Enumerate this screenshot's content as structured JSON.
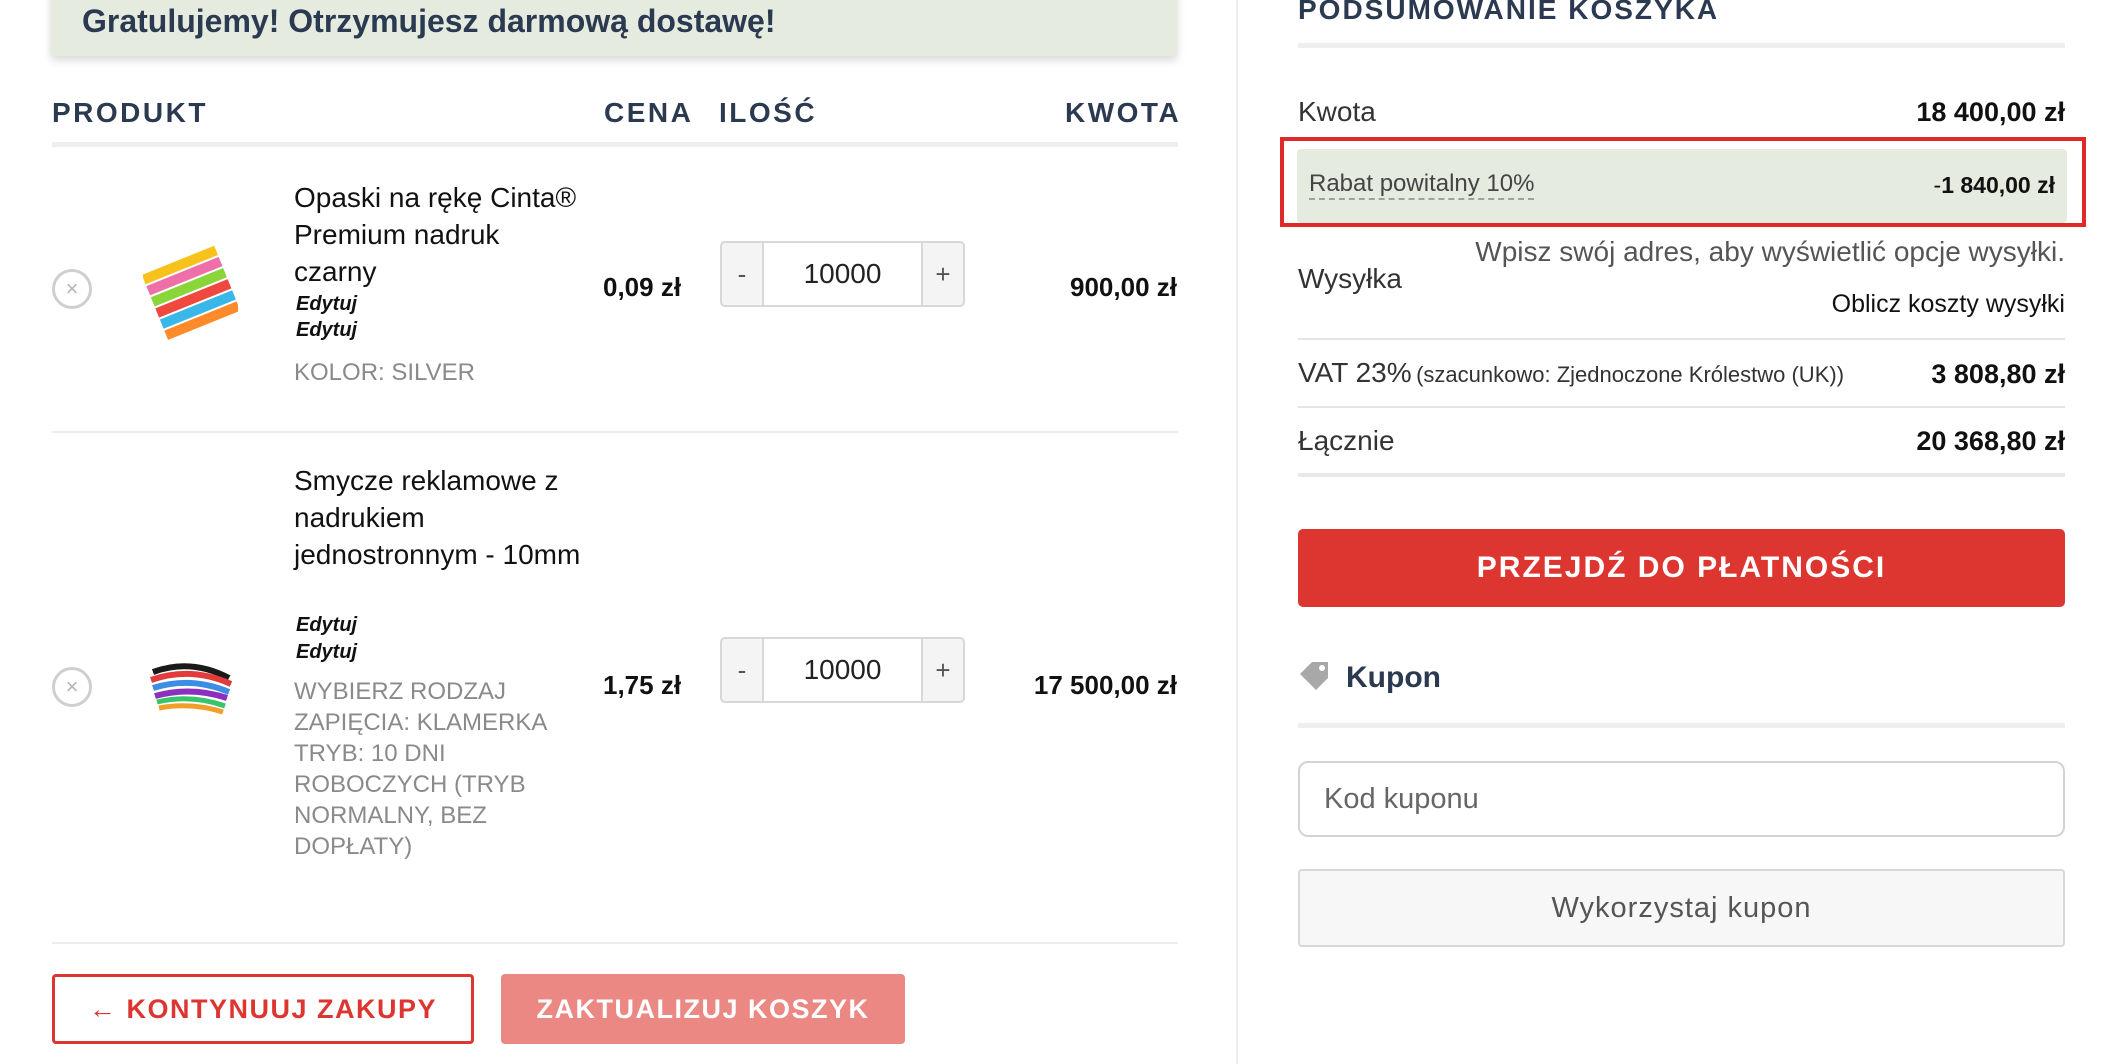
{
  "banner": {
    "text": "Gratulujemy! Otrzymujesz darmową dostawę!"
  },
  "table": {
    "headers": {
      "product": "PRODUKT",
      "price": "CENA",
      "qty": "ILOŚĆ",
      "amount": "KWOTA"
    },
    "rows": [
      {
        "name": "Opaski na rękę Cinta® Premium nadruk czarny",
        "edit_links": [
          "Edytuj",
          "Edytuj"
        ],
        "meta": "KOLOR: SILVER",
        "price": "0,09 zł",
        "qty": "10000",
        "amount": "900,00 zł",
        "thumb_icon": "wristbands-thumbnail"
      },
      {
        "name": "Smycze reklamowe z nadrukiem jednostronnym - 10mm",
        "edit_links": [
          "Edytuj",
          "Edytuj"
        ],
        "meta": "WYBIERZ RODZAJ ZAPIĘCIA: KLAMERKA TRYB: 10 DNI ROBOCZYCH (TRYB NORMALNY, BEZ DOPŁATY)",
        "price": "1,75 zł",
        "qty": "10000",
        "amount": "17 500,00 zł",
        "thumb_icon": "lanyards-thumbnail"
      }
    ],
    "qty_minus": "-",
    "qty_plus": "+",
    "remove_glyph": "×"
  },
  "actions": {
    "continue_label": "← KONTYNUUJ ZAKUPY",
    "update_label": "ZAKTUALIZUJ KOSZYK"
  },
  "summary": {
    "title": "PODSUMOWANIE KOSZYKA",
    "subtotal_label": "Kwota",
    "subtotal_value": "18 400,00 zł",
    "discount_label": "Rabat powitalny 10%",
    "discount_sign": "-",
    "discount_value": "1 840,00 zł",
    "shipping_label": "Wysyłka",
    "shipping_note": "Wpisz swój adres, aby wyświetlić opcje wysyłki.",
    "shipping_calc": "Oblicz koszty wysyłki",
    "vat_label": "VAT 23%",
    "vat_note": "(szacunkowo: Zjednoczone Królestwo (UK))",
    "vat_value": "3 808,80 zł",
    "total_label": "Łącznie",
    "total_value": "20 368,80 zł",
    "checkout_label": "PRZEJDŹ DO PŁATNOŚCI"
  },
  "coupon": {
    "title": "Kupon",
    "icon": "tag-icon",
    "placeholder": "Kod kuponu",
    "apply_label": "Wykorzystaj kupon"
  },
  "colors": {
    "accent_red": "#dd3631",
    "banner_bg": "#e6ebe0",
    "heading": "#2b3a50",
    "highlight_border": "#e02a2a"
  }
}
